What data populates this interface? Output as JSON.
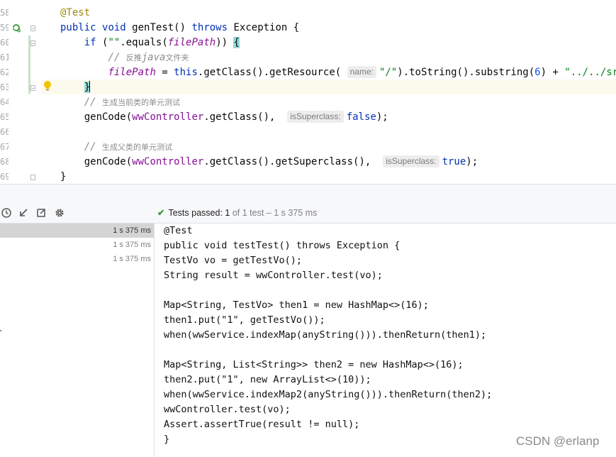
{
  "editor": {
    "line_numbers": [
      "58",
      "59",
      "60",
      "61",
      "62",
      "63",
      "64",
      "65",
      "66",
      "67",
      "68",
      "69"
    ],
    "lines": [
      {
        "tokens": [
          {
            "c": "ann",
            "t": "@Test"
          }
        ]
      },
      {
        "tokens": [
          {
            "c": "kw",
            "t": "public "
          },
          {
            "c": "kw",
            "t": "void "
          },
          {
            "c": "",
            "t": "genTest() "
          },
          {
            "c": "kw",
            "t": "throws "
          },
          {
            "c": "",
            "t": "Exception {"
          }
        ]
      },
      {
        "tokens": [
          {
            "c": "",
            "t": "    "
          },
          {
            "c": "kw",
            "t": "if "
          },
          {
            "c": "",
            "t": "("
          },
          {
            "c": "str",
            "t": "\"\""
          },
          {
            "c": "",
            "t": ".equals("
          },
          {
            "c": "fldi",
            "t": "filePath"
          },
          {
            "c": "",
            "t": ")) "
          },
          {
            "c": "brace-hl",
            "t": "{"
          }
        ]
      },
      {
        "tokens": [
          {
            "c": "",
            "t": "        "
          },
          {
            "c": "cmt",
            "t": "// "
          },
          {
            "c": "cmtcn",
            "t": "反推"
          },
          {
            "c": "cmt",
            "t": "java"
          },
          {
            "c": "cmtcn",
            "t": "文件夹"
          }
        ]
      },
      {
        "tokens": [
          {
            "c": "",
            "t": "        "
          },
          {
            "c": "fldi",
            "t": "filePath"
          },
          {
            "c": "",
            "t": " = "
          },
          {
            "c": "kw",
            "t": "this"
          },
          {
            "c": "",
            "t": ".getClass().getResource( "
          },
          {
            "c": "hint",
            "t": "name:"
          },
          {
            "c": "str",
            "t": "\"/\""
          },
          {
            "c": "",
            "t": ").toString().substring("
          },
          {
            "c": "num",
            "t": "6"
          },
          {
            "c": "",
            "t": ") + "
          },
          {
            "c": "str",
            "t": "\"../../src/\""
          },
          {
            "c": "",
            "t": ";"
          }
        ]
      },
      {
        "tokens": [
          {
            "c": "",
            "t": "    "
          },
          {
            "c": "brace-hl",
            "t": "}"
          },
          {
            "c": "caret",
            "t": ""
          }
        ]
      },
      {
        "tokens": [
          {
            "c": "",
            "t": "    "
          },
          {
            "c": "cmt",
            "t": "// "
          },
          {
            "c": "cmtcn",
            "t": "生成当前类的单元测试"
          }
        ]
      },
      {
        "tokens": [
          {
            "c": "",
            "t": "    genCode("
          },
          {
            "c": "fld",
            "t": "wwController"
          },
          {
            "c": "",
            "t": ".getClass(),  "
          },
          {
            "c": "hint",
            "t": "isSuperclass:"
          },
          {
            "c": "kw",
            "t": "false"
          },
          {
            "c": "",
            "t": ");"
          }
        ]
      },
      {
        "tokens": []
      },
      {
        "tokens": [
          {
            "c": "",
            "t": "    "
          },
          {
            "c": "cmt",
            "t": "// "
          },
          {
            "c": "cmtcn",
            "t": "生成父类的单元测试"
          }
        ]
      },
      {
        "tokens": [
          {
            "c": "",
            "t": "    genCode("
          },
          {
            "c": "fld",
            "t": "wwController"
          },
          {
            "c": "",
            "t": ".getClass().getSuperclass(),  "
          },
          {
            "c": "hint",
            "t": "isSuperclass:"
          },
          {
            "c": "kw",
            "t": "true"
          },
          {
            "c": "",
            "t": ");"
          }
        ]
      },
      {
        "tokens": [
          {
            "c": "",
            "t": "}"
          }
        ]
      }
    ]
  },
  "run_panel": {
    "icons": [
      "history-icon",
      "import-icon",
      "export-icon",
      "settings-icon"
    ],
    "status": {
      "label": "Tests passed:",
      "passed": "1",
      "rest": "of 1 test – 1 s 375 ms"
    },
    "tree_rows": [
      {
        "time": "1 s 375 ms",
        "selected": true
      },
      {
        "time": "1 s 375 ms",
        "selected": false
      },
      {
        "time": "1 s 375 ms",
        "selected": false
      }
    ],
    "console_lines": [
      "@Test",
      "public void testTest() throws Exception {",
      "TestVo vo = getTestVo();",
      "String result = wwController.test(vo);",
      "",
      "Map<String, TestVo> then1 = new HashMap<>(16);",
      "then1.put(\"1\", getTestVo());",
      "when(wwService.indexMap(anyString())).thenReturn(then1);",
      "",
      "Map<String, List<String>> then2 = new HashMap<>(16);",
      "then2.put(\"1\", new ArrayList<>(10));",
      "when(wwService.indexMap2(anyString())).thenReturn(then2);",
      "wwController.test(vo);",
      "Assert.assertTrue(result != null);",
      "}"
    ]
  },
  "watermark": "CSDN @erlanp"
}
